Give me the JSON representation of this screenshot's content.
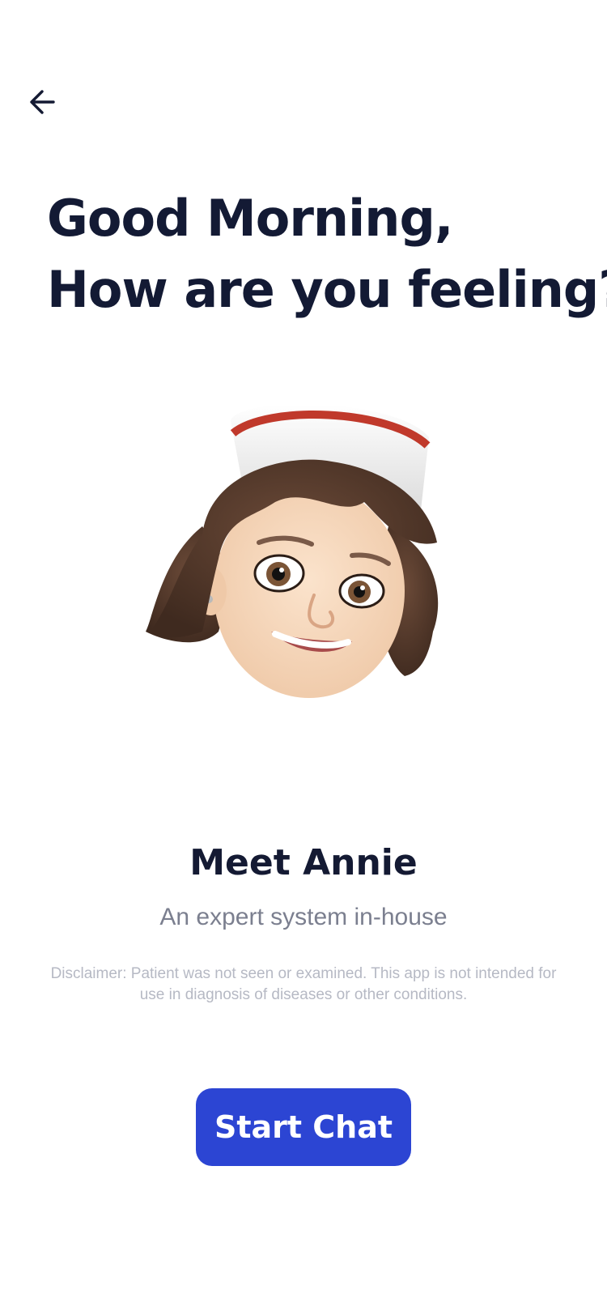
{
  "header": {
    "back_icon": "arrow-left-icon"
  },
  "greeting": {
    "line1": "Good Morning,",
    "line2": "How are you feeling?"
  },
  "assistant": {
    "avatar_icon": "nurse-memoji-avatar",
    "name": "Meet Annie",
    "subtitle": "An expert system in-house"
  },
  "disclaimer": "Disclaimer: Patient was not seen or examined. This app is not intended for use in diagnosis of diseases or other conditions.",
  "cta": {
    "label": "Start Chat"
  },
  "colors": {
    "primary": "#2C45D3",
    "text_dark": "#131A34",
    "text_muted": "#7B7F8F",
    "text_faint": "#B6B9C4"
  }
}
